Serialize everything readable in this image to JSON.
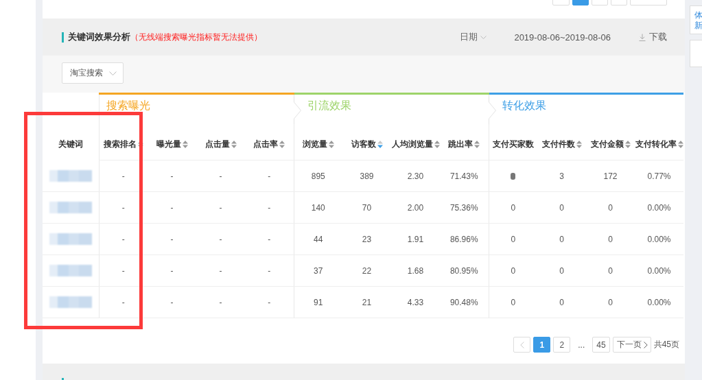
{
  "previous_pagination": {
    "buttons": [
      {
        "kind": "prev",
        "selected": false
      },
      {
        "kind": "page",
        "selected": true
      },
      {
        "kind": "page",
        "selected": false
      },
      {
        "kind": "page",
        "selected": false
      },
      {
        "kind": "next",
        "selected": false
      }
    ]
  },
  "side_panel": {
    "tab_lines": [
      "体",
      "新"
    ]
  },
  "section": {
    "title": "关键词效果分析",
    "note": "（无线端搜索曝光指标暂无法提供）",
    "date_label": "日期",
    "date_range": "2019-08-06~2019-08-06",
    "download": "下载"
  },
  "filter": {
    "value": "淘宝搜索"
  },
  "table": {
    "keyword_column": "关键词",
    "groups": [
      {
        "label": "搜索曝光",
        "color": "#f5a623",
        "columns": [
          {
            "label": "搜索排名",
            "sortable": true,
            "sorted_descending": false
          },
          {
            "label": "曝光量",
            "sortable": true,
            "sorted_descending": false
          },
          {
            "label": "点击量",
            "sortable": true,
            "sorted_descending": false
          },
          {
            "label": "点击率",
            "sortable": true,
            "sorted_descending": false
          }
        ]
      },
      {
        "label": "引流效果",
        "color": "#9ed46a",
        "columns": [
          {
            "label": "浏览量",
            "sortable": true,
            "sorted_descending": false
          },
          {
            "label": "访客数",
            "sortable": true,
            "sorted_descending": true
          },
          {
            "label": "人均浏览量",
            "sortable": true,
            "sorted_descending": false
          },
          {
            "label": "跳出率",
            "sortable": true,
            "sorted_descending": false
          }
        ]
      },
      {
        "label": "转化效果",
        "color": "#3e9fe6",
        "columns": [
          {
            "label": "支付买家数",
            "sortable": false
          },
          {
            "label": "支付件数",
            "sortable": true,
            "sorted_descending": false
          },
          {
            "label": "支付金额",
            "sortable": true,
            "sorted_descending": false
          },
          {
            "label": "支付转化率",
            "sortable": true,
            "sorted_descending": false
          }
        ]
      }
    ],
    "rows": [
      {
        "keyword_redacted": true,
        "values": [
          "-",
          "-",
          "-",
          "-",
          "895",
          "389",
          "2.30",
          "71.43%",
          {
            "kind": "blurred"
          },
          "3",
          "172",
          "0.77%"
        ]
      },
      {
        "keyword_redacted": true,
        "values": [
          "-",
          "-",
          "-",
          "-",
          "140",
          "70",
          "2.00",
          "75.36%",
          "0",
          "0",
          "0",
          "0.00%"
        ]
      },
      {
        "keyword_redacted": true,
        "values": [
          "-",
          "-",
          "-",
          "-",
          "44",
          "23",
          "1.91",
          "86.96%",
          "0",
          "0",
          "0",
          "0.00%"
        ]
      },
      {
        "keyword_redacted": true,
        "values": [
          "-",
          "-",
          "-",
          "-",
          "37",
          "22",
          "1.68",
          "80.95%",
          "0",
          "0",
          "0",
          "0.00%"
        ]
      },
      {
        "keyword_redacted": true,
        "values": [
          "-",
          "-",
          "-",
          "-",
          "91",
          "21",
          "4.33",
          "90.48%",
          "0",
          "0",
          "0",
          "0.00%"
        ]
      }
    ]
  },
  "pagination": {
    "prev_disabled": true,
    "pages": [
      {
        "kind": "page",
        "label": "1",
        "selected": true
      },
      {
        "kind": "page",
        "label": "2",
        "selected": false
      },
      {
        "kind": "ellipsis",
        "label": "..."
      },
      {
        "kind": "page",
        "label": "45",
        "selected": false
      }
    ],
    "next": "下一页",
    "total": "共45页"
  },
  "annotations": [
    {
      "kind": "rectangle"
    }
  ]
}
